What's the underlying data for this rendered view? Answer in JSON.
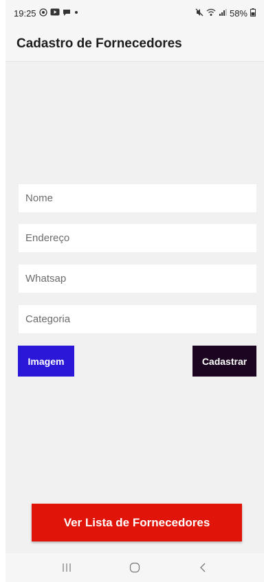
{
  "status_bar": {
    "time": "19:25",
    "battery": "58%",
    "left_icons": [
      "whatsapp-icon",
      "youtube-icon",
      "message-icon",
      "dot-icon"
    ],
    "right_icons": [
      "mute-icon",
      "wifi-icon",
      "signal-icon",
      "battery-icon"
    ]
  },
  "header": {
    "title": "Cadastro de Fornecedores"
  },
  "form": {
    "nome_placeholder": "Nome",
    "endereco_placeholder": "Endereço",
    "whatsapp_placeholder": "Whatsap",
    "categoria_placeholder": "Categoria",
    "nome_value": "",
    "endereco_value": "",
    "whatsapp_value": "",
    "categoria_value": ""
  },
  "buttons": {
    "imagem": "Imagem",
    "cadastrar": "Cadastrar",
    "ver_lista": "Ver Lista de Fornecedores"
  },
  "colors": {
    "imagem_button": "#2a17d8",
    "cadastrar_button": "#1b0520",
    "ver_lista_button": "#e01409",
    "background": "#f1f1f1"
  },
  "nav_bar": {
    "icons": [
      "recent-apps-icon",
      "home-icon",
      "back-icon"
    ]
  }
}
